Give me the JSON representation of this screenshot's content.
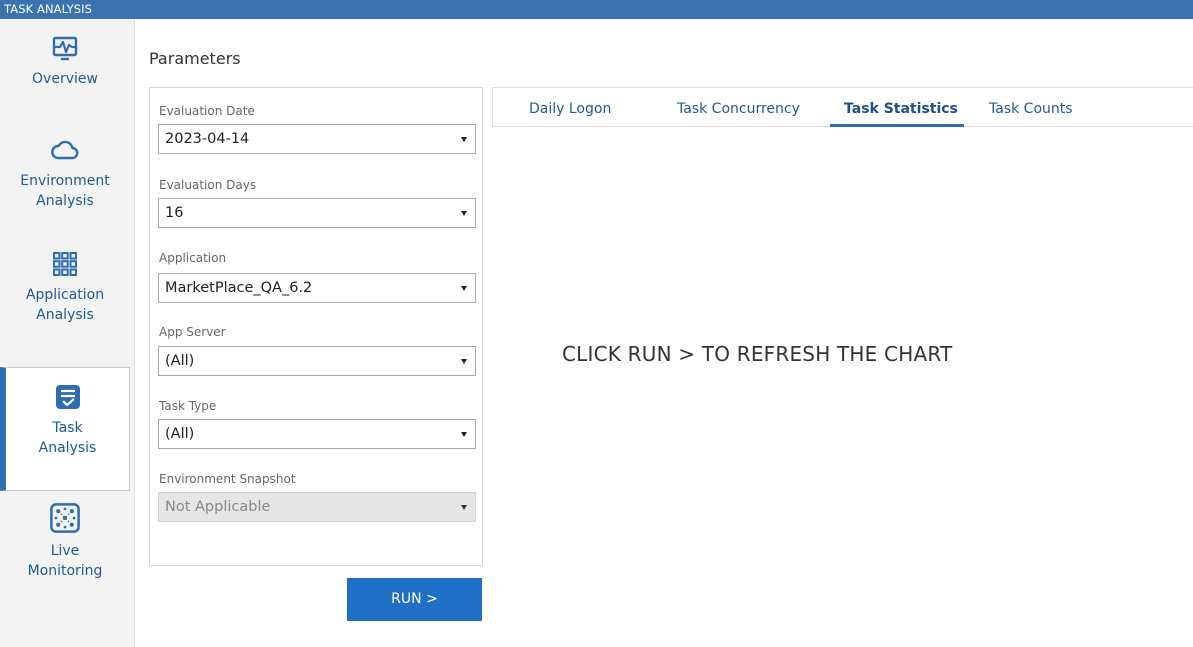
{
  "window": {
    "title": "TASK ANALYSIS"
  },
  "sidebar": {
    "items": [
      {
        "label": "Overview",
        "icon": "activity-monitor-icon",
        "active": false
      },
      {
        "label": "Environment Analysis",
        "line1": "Environment",
        "line2": "Analysis",
        "icon": "cloud-icon",
        "active": false
      },
      {
        "label": "Application Analysis",
        "line1": "Application",
        "line2": "Analysis",
        "icon": "grid-icon",
        "active": false
      },
      {
        "label": "Task Analysis",
        "line1": "Task",
        "line2": "Analysis",
        "icon": "task-check-icon",
        "active": true
      },
      {
        "label": "Live Monitoring",
        "line1": "Live",
        "line2": "Monitoring",
        "icon": "network-nodes-icon",
        "active": false
      }
    ],
    "accent": "#2e6db0"
  },
  "parameters": {
    "title": "Parameters",
    "fields": [
      {
        "label": "Evaluation Date",
        "value": "2023-04-14",
        "disabled": false
      },
      {
        "label": "Evaluation Days",
        "value": "16",
        "disabled": false
      },
      {
        "label": "Application",
        "value": "MarketPlace_QA_6.2",
        "disabled": false
      },
      {
        "label": "App Server",
        "value": "(All)",
        "disabled": false
      },
      {
        "label": "Task Type",
        "value": "(All)",
        "disabled": false
      },
      {
        "label": "Environment Snapshot",
        "value": "Not Applicable",
        "disabled": true
      }
    ],
    "run_label": "RUN >"
  },
  "tabs": [
    {
      "label": "Daily Logon",
      "active": false
    },
    {
      "label": "Task Concurrency",
      "active": false
    },
    {
      "label": "Task Statistics",
      "active": true
    },
    {
      "label": "Task Counts",
      "active": false
    }
  ],
  "chart": {
    "message": "CLICK RUN > TO REFRESH THE CHART"
  },
  "colors": {
    "titlebar": "#3b73b0",
    "run_button": "#1f6fc5",
    "nav_text": "#1f5a94"
  }
}
